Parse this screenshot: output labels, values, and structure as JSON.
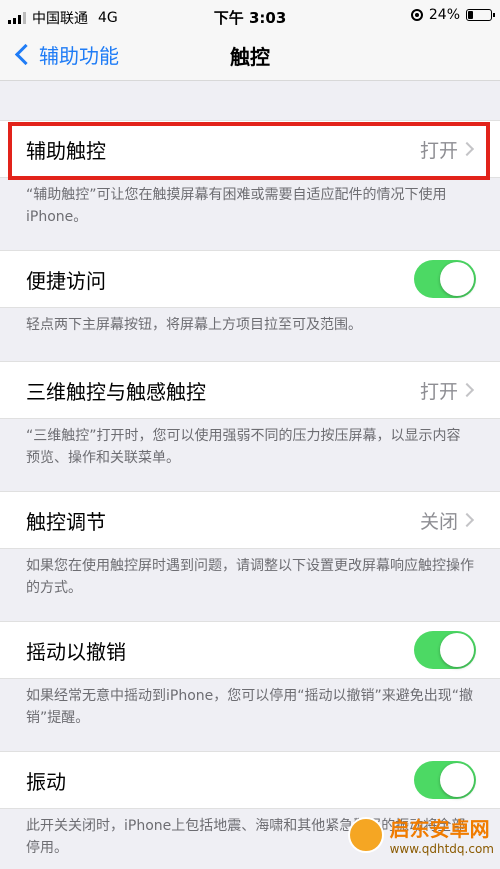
{
  "status_bar": {
    "carrier": "中国联通",
    "network": "4G",
    "time": "下午 3:03",
    "battery_percent": "24%",
    "battery_level": 0.24
  },
  "nav": {
    "back_label": "辅助功能",
    "title": "触控"
  },
  "cells": [
    {
      "label": "辅助触控",
      "value": "打开",
      "footer": "“辅助触控”可让您在触摸屏幕有困难或需要自适应配件的情况下使用 iPhone。"
    },
    {
      "label": "便捷访问",
      "toggle": true,
      "footer": "轻点两下主屏幕按钮，将屏幕上方项目拉至可及范围。"
    },
    {
      "label": "三维触控与触感触控",
      "value": "打开",
      "footer": "“三维触控”打开时，您可以使用强弱不同的压力按压屏幕，以显示内容预览、操作和关联菜单。"
    },
    {
      "label": "触控调节",
      "value": "关闭",
      "footer": "如果您在使用触控屏时遇到问题，请调整以下设置更改屏幕响应触控操作的方式。"
    },
    {
      "label": "摇动以撤销",
      "toggle": true,
      "footer": "如果经常无意中摇动到iPhone，您可以停用“摇动以撤销”来避免出现“撤销”提醒。"
    },
    {
      "label": "振动",
      "toggle": true,
      "footer": "此开关关闭时，iPhone上包括地震、海啸和其他紧急警报的振动将全部停用。"
    }
  ],
  "watermark": {
    "title": "启东安卓网",
    "url": "www.qdhtdq.com"
  },
  "colors": {
    "accent": "#1f7cf6",
    "toggle_on": "#4cd964",
    "highlight": "#e2231a"
  }
}
